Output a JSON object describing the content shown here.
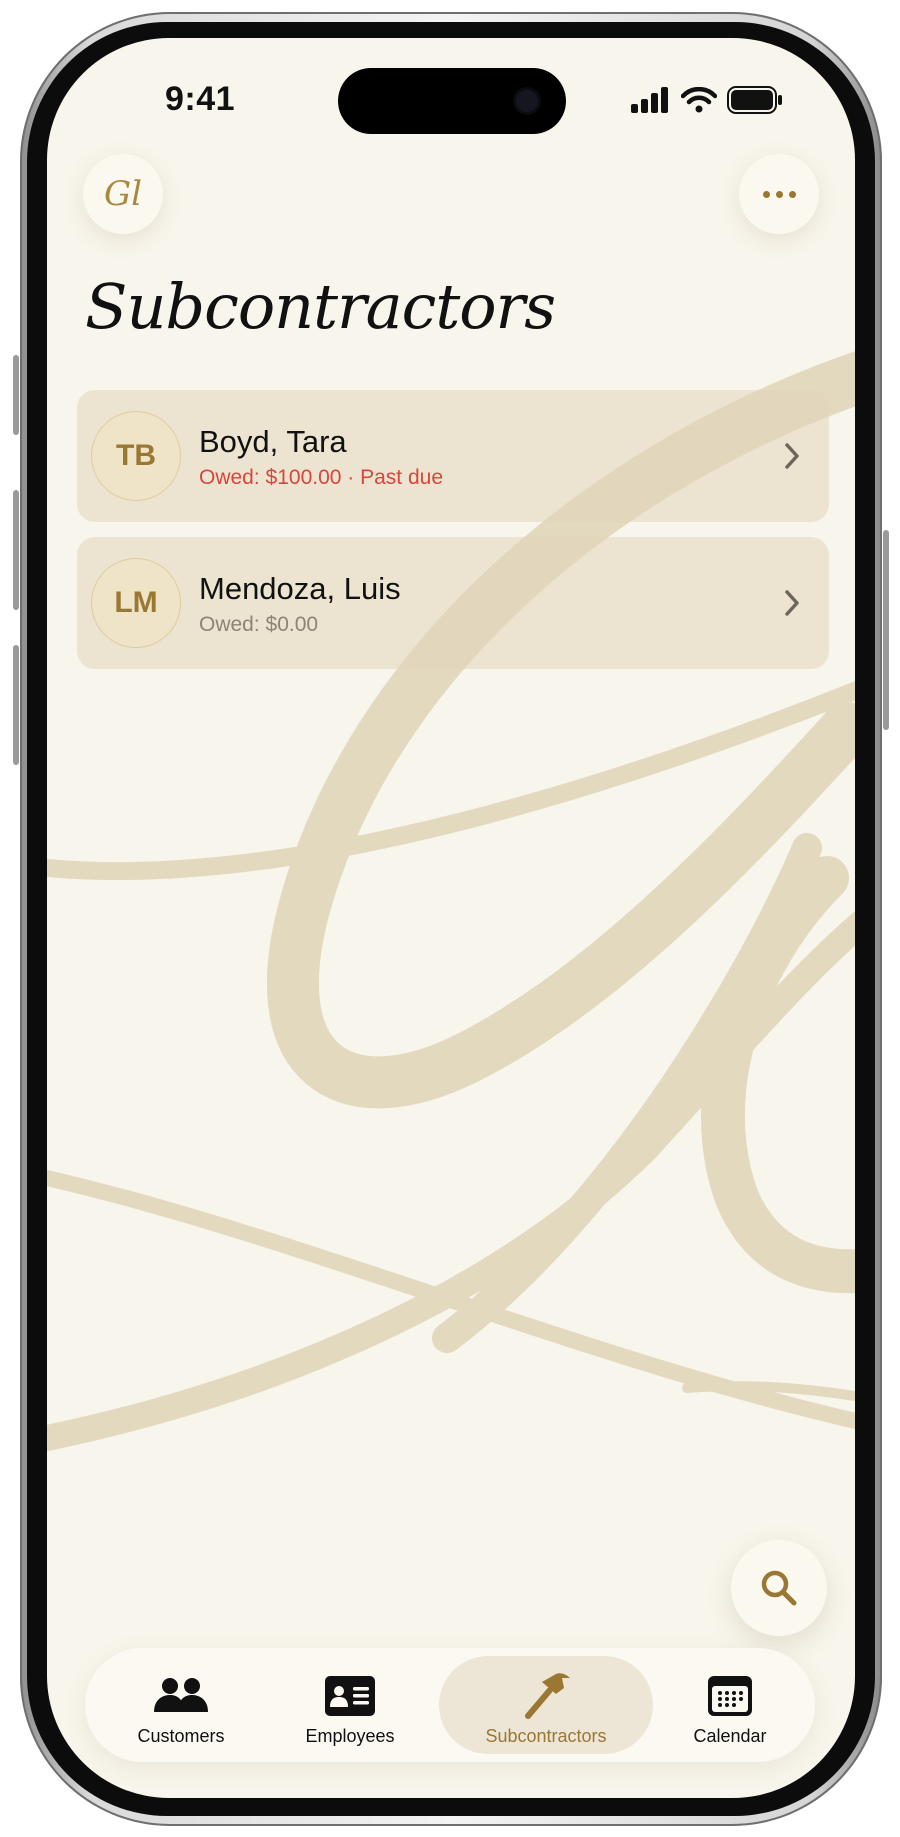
{
  "status_bar": {
    "time": "9:41"
  },
  "header": {
    "logo_text": "Gl",
    "title": "Subcontractors"
  },
  "subcontractors": [
    {
      "initials": "TB",
      "name": "Boyd, Tara",
      "owed": "Owed: $100.00 · Past due",
      "status": "past-due"
    },
    {
      "initials": "LM",
      "name": "Mendoza, Luis",
      "owed": "Owed: $0.00",
      "status": "ok"
    }
  ],
  "tabs": [
    {
      "label": "Customers",
      "icon": "people-icon"
    },
    {
      "label": "Employees",
      "icon": "id-card-icon"
    },
    {
      "label": "Subcontractors",
      "icon": "hammer-icon",
      "active": true
    },
    {
      "label": "Calendar",
      "icon": "calendar-icon"
    }
  ],
  "colors": {
    "background": "#f8f5ec",
    "accent": "#9a7733",
    "past_due": "#d8463c",
    "watermark": "#e3d9be"
  }
}
